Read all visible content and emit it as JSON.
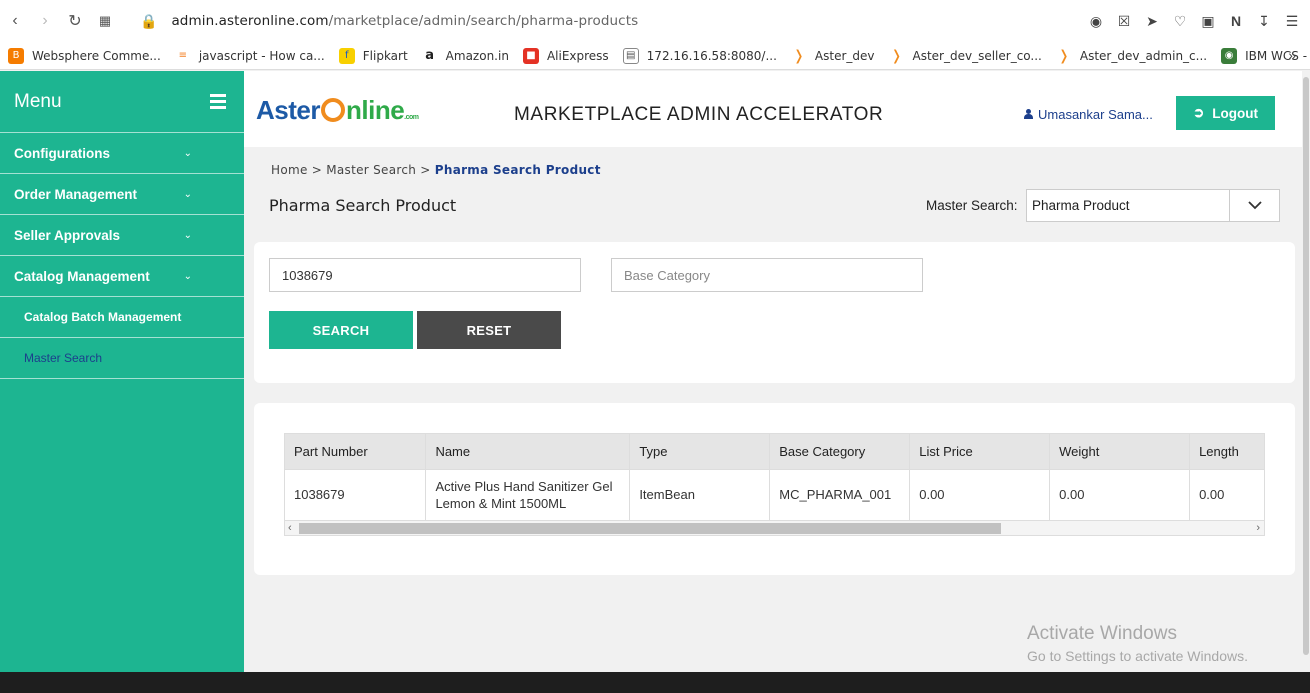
{
  "browser": {
    "url_host": "admin.asteronline.com",
    "url_path": "/marketplace/admin/search/pharma-products",
    "bookmarks": [
      {
        "label": "Websphere Comme...",
        "icon": "blogger-icon",
        "color": "#f57c00"
      },
      {
        "label": "javascript - How ca...",
        "icon": "stackoverflow-icon",
        "color": "#f48024"
      },
      {
        "label": "Flipkart",
        "icon": "flipkart-icon",
        "color": "#f8d000"
      },
      {
        "label": "Amazon.in",
        "icon": "amazon-icon",
        "color": "#222222"
      },
      {
        "label": "AliExpress",
        "icon": "aliexpress-icon",
        "color": "#e43225"
      },
      {
        "label": "172.16.16.58:8080/...",
        "icon": "page-icon",
        "color": "#888888"
      },
      {
        "label": "Aster_dev",
        "icon": "aster-icon",
        "color": "#f08c1e"
      },
      {
        "label": "Aster_dev_seller_co...",
        "icon": "aster-icon",
        "color": "#f08c1e"
      },
      {
        "label": "Aster_dev_admin_c...",
        "icon": "aster-icon",
        "color": "#f08c1e"
      },
      {
        "label": "IBM WCS - Promoti...",
        "icon": "ibm-icon",
        "color": "#3a7d3a"
      }
    ]
  },
  "sidebar": {
    "title": "Menu",
    "items": [
      {
        "label": "Configurations"
      },
      {
        "label": "Order Management"
      },
      {
        "label": "Seller Approvals"
      },
      {
        "label": "Catalog Management"
      }
    ],
    "subitems": [
      {
        "label": "Catalog Batch Management"
      },
      {
        "label": "Master Search"
      }
    ]
  },
  "header": {
    "logo_part1": "Aster",
    "logo_part2": "nline",
    "logo_suffix": ".com",
    "title": "MARKETPLACE ADMIN ACCELERATOR",
    "user": "Umasankar Sama...",
    "logout_label": "Logout"
  },
  "breadcrumb": {
    "home": "Home",
    "sep": " > ",
    "master": "Master Search",
    "current": "Pharma Search Product"
  },
  "page": {
    "title": "Pharma Search Product",
    "master_search_label": "Master Search:",
    "master_search_value": "Pharma Product"
  },
  "search": {
    "part_number_value": "1038679",
    "base_category_placeholder": "Base Category",
    "search_label": "SEARCH",
    "reset_label": "RESET"
  },
  "results": {
    "columns": [
      "Part Number",
      "Name",
      "Type",
      "Base Category",
      "List Price",
      "Weight",
      "Length"
    ],
    "rows": [
      [
        "1038679",
        "Active Plus Hand Sanitizer Gel Lemon & Mint 1500ML",
        "ItemBean",
        "MC_PHARMA_001",
        "0.00",
        "0.00",
        "0.00"
      ]
    ]
  },
  "watermark": {
    "line1": "Activate Windows",
    "line2": "Go to Settings to activate Windows."
  },
  "colors": {
    "accent": "#1db591",
    "reset_button": "#4a4a4a",
    "link_blue": "#1c3f8c"
  }
}
